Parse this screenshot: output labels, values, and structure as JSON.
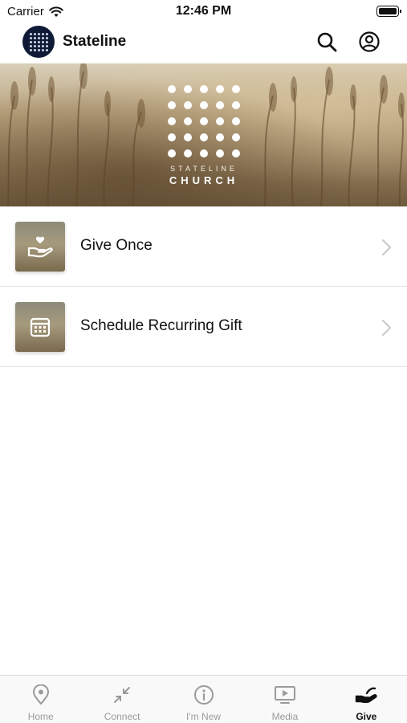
{
  "status_bar": {
    "carrier": "Carrier",
    "time": "12:46 PM",
    "icons": [
      "wifi-icon",
      "battery-icon"
    ]
  },
  "header": {
    "title": "Stateline",
    "logo": "stateline-church-logo",
    "actions": [
      {
        "name": "search",
        "icon": "search-icon"
      },
      {
        "name": "profile",
        "icon": "user-circle-icon"
      }
    ]
  },
  "banner": {
    "subtitle": "STATELINE",
    "title": "CHURCH",
    "image": "wheat-field"
  },
  "give_options": [
    {
      "label": "Give Once",
      "icon": "hand-heart-icon"
    },
    {
      "label": "Schedule Recurring Gift",
      "icon": "calendar-icon"
    }
  ],
  "tab_bar": {
    "tabs": [
      {
        "label": "Home",
        "icon": "location-pin-icon",
        "active": false
      },
      {
        "label": "Connect",
        "icon": "arrows-in-icon",
        "active": false
      },
      {
        "label": "I'm New",
        "icon": "info-circle-icon",
        "active": false
      },
      {
        "label": "Media",
        "icon": "play-screen-icon",
        "active": false
      },
      {
        "label": "Give",
        "icon": "giving-hand-icon",
        "active": true
      }
    ]
  },
  "colors": {
    "logo_bg": "#0e1a36",
    "active_tab": "#111111",
    "inactive_tab": "#9a9a9a",
    "divider": "#e3e3e3"
  }
}
